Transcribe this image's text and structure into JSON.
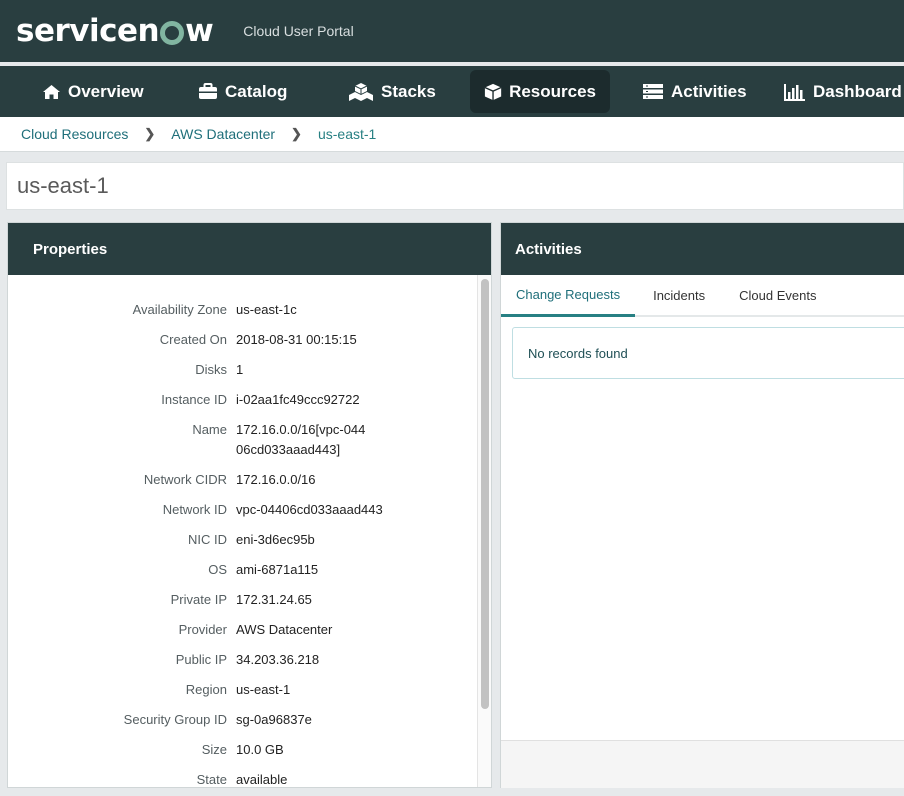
{
  "header": {
    "logo_text_pre": "servicen",
    "logo_text_post": "w",
    "portal_title": "Cloud User Portal"
  },
  "nav": {
    "items": [
      {
        "label": "Overview",
        "icon": "home-icon"
      },
      {
        "label": "Catalog",
        "icon": "briefcase-icon"
      },
      {
        "label": "Stacks",
        "icon": "cubes-icon"
      },
      {
        "label": "Resources",
        "icon": "cube-icon",
        "active": true
      },
      {
        "label": "Activities",
        "icon": "list-icon"
      },
      {
        "label": "Dashboard",
        "icon": "bar-chart-icon"
      }
    ]
  },
  "breadcrumb": [
    "Cloud Resources",
    "AWS Datacenter",
    "us-east-1"
  ],
  "page_title": "us-east-1",
  "properties": {
    "title": "Properties",
    "rows": [
      {
        "label": "Availability Zone",
        "value": "us-east-1c"
      },
      {
        "label": "Created On",
        "value": "2018-08-31 00:15:15"
      },
      {
        "label": "Disks",
        "value": "1"
      },
      {
        "label": "Instance ID",
        "value": "i-02aa1fc49ccc92722"
      },
      {
        "label": "Name",
        "value": "172.16.0.0/16[vpc-04406cd033aaad443]"
      },
      {
        "label": "Network CIDR",
        "value": "172.16.0.0/16"
      },
      {
        "label": "Network ID",
        "value": "vpc-04406cd033aaad443"
      },
      {
        "label": "NIC ID",
        "value": "eni-3d6ec95b"
      },
      {
        "label": "OS",
        "value": "ami-6871a115"
      },
      {
        "label": "Private IP",
        "value": "172.31.24.65"
      },
      {
        "label": "Provider",
        "value": "AWS Datacenter"
      },
      {
        "label": "Public IP",
        "value": "34.203.36.218"
      },
      {
        "label": "Region",
        "value": "us-east-1"
      },
      {
        "label": "Security Group ID",
        "value": "sg-0a96837e"
      },
      {
        "label": "Size",
        "value": "10.0 GB"
      },
      {
        "label": "State",
        "value": "available"
      }
    ]
  },
  "activities": {
    "title": "Activities",
    "tabs": [
      "Change Requests",
      "Incidents",
      "Cloud Events"
    ],
    "active_tab": "Change Requests",
    "empty_message": "No records found"
  },
  "colors": {
    "header_bg": "#293e40",
    "accent": "#81b5a1",
    "active_tab": "#278083"
  }
}
